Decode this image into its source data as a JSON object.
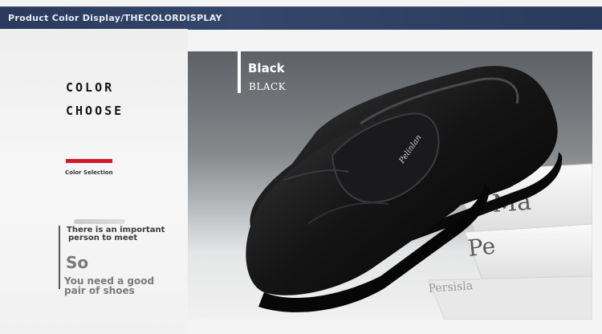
{
  "header": {
    "title": "Product Color Display/THECOLORDISPLAY"
  },
  "left": {
    "title_line1": "COLOR",
    "title_line2": "CHOOSE",
    "color_selection": "Color Selection",
    "important_line1": "There is an important",
    "important_line2": "person to meet",
    "so": "So",
    "need_line1": "You need a good",
    "need_line2": "pair of shoes"
  },
  "product": {
    "color_name": "Black",
    "color_name_caps": "BLACK",
    "shoe_logo_text": "Pelinlan",
    "book_spine_texts": [
      "Ma",
      "Pe",
      "Persisla"
    ]
  },
  "colors": {
    "header_bar": "#2a3a5c",
    "accent_red": "#d1192b",
    "shoe_black": "#141414"
  }
}
